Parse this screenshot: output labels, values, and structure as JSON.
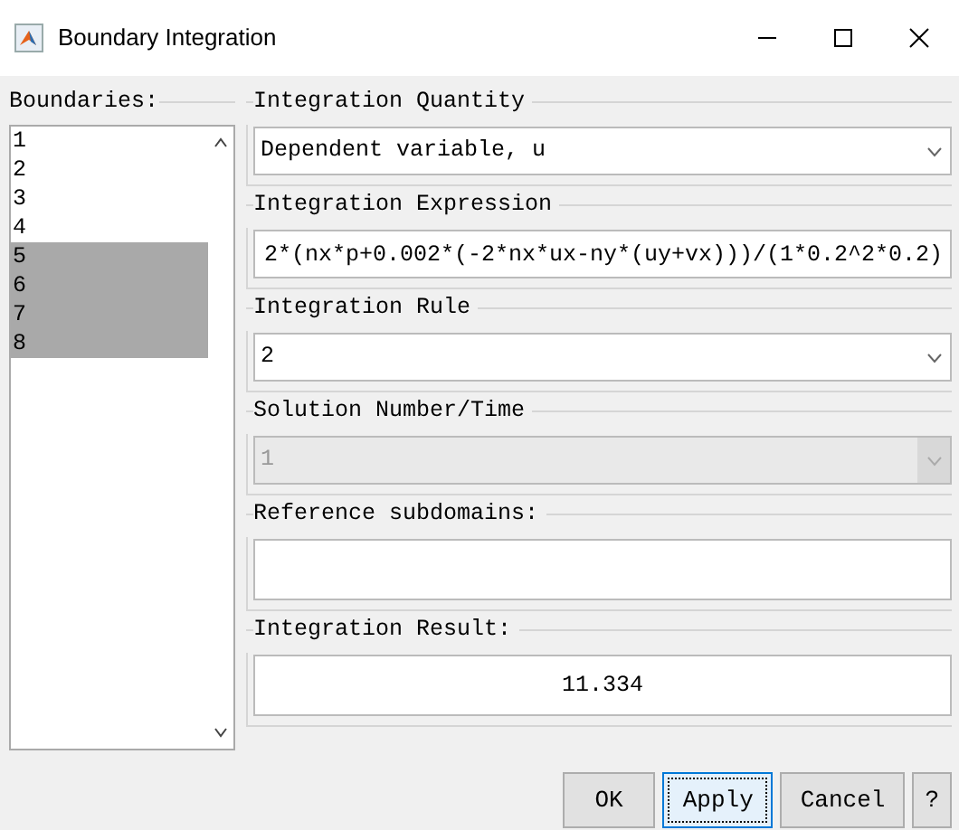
{
  "window": {
    "title": "Boundary Integration"
  },
  "boundaries": {
    "label": "Boundaries:",
    "items": [
      {
        "label": "1",
        "selected": false
      },
      {
        "label": "2",
        "selected": false
      },
      {
        "label": "3",
        "selected": false
      },
      {
        "label": "4",
        "selected": false
      },
      {
        "label": "5",
        "selected": true
      },
      {
        "label": "6",
        "selected": true
      },
      {
        "label": "7",
        "selected": true
      },
      {
        "label": "8",
        "selected": true
      }
    ]
  },
  "groups": [
    {
      "kind": "select",
      "label": "Integration Quantity",
      "value": "Dependent variable, u",
      "disabled": false
    },
    {
      "kind": "input",
      "label": "Integration Expression",
      "value": "2*(nx*p+0.002*(-2*nx*ux-ny*(uy+vx)))/(1*0.2^2*0.2)"
    },
    {
      "kind": "select",
      "label": "Integration Rule",
      "value": "2",
      "disabled": false
    },
    {
      "kind": "select",
      "label": "Solution Number/Time",
      "value": "1",
      "disabled": true
    },
    {
      "kind": "input",
      "label": "Reference subdomains:"
    },
    {
      "kind": "output",
      "label": "Integration Result:",
      "value": "11.334"
    }
  ],
  "buttons": [
    {
      "label": "OK",
      "focused": false
    },
    {
      "label": "Apply",
      "focused": true
    },
    {
      "label": "Cancel",
      "focused": false
    },
    {
      "label": "?",
      "focused": false
    }
  ]
}
